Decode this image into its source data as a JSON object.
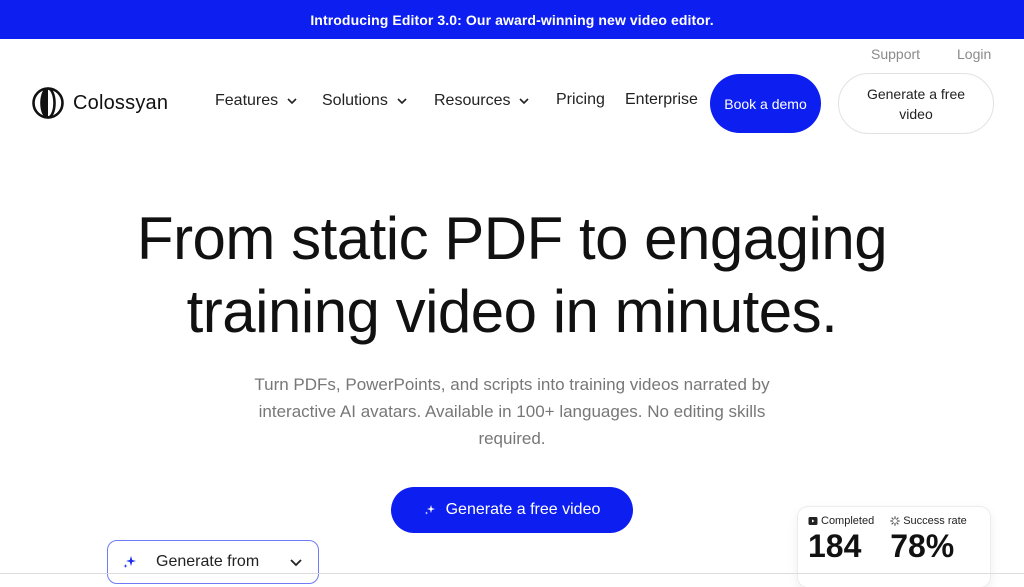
{
  "banner": {
    "text": "Introducing Editor 3.0: Our award-winning new video editor."
  },
  "utility_nav": {
    "support": "Support",
    "login": "Login"
  },
  "brand": {
    "name": "Colossyan"
  },
  "nav": {
    "items": [
      {
        "label": "Features",
        "has_dropdown": true
      },
      {
        "label": "Solutions",
        "has_dropdown": true
      },
      {
        "label": "Resources",
        "has_dropdown": true
      },
      {
        "label": "Pricing",
        "has_dropdown": false
      },
      {
        "label": "Enterprise",
        "has_dropdown": false
      }
    ],
    "book_demo": "Book a demo",
    "generate_free": "Generate a free video"
  },
  "hero": {
    "title_line1": "From static PDF to engaging",
    "title_line2": "training video in minutes.",
    "subtitle": "Turn PDFs, PowerPoints, and scripts into training videos narrated by interactive  AI avatars. Available in 100+ languages. No editing skills required.",
    "cta": "Generate a free video"
  },
  "generate_from": {
    "label": "Generate from"
  },
  "stats": {
    "completed_label": "Completed",
    "completed_value": "184",
    "success_label": "Success rate",
    "success_value": "78%"
  },
  "colors": {
    "brand_blue": "#0d1ff0",
    "muted_text": "#777777"
  },
  "icons": {
    "logo": "colossyan-logo-icon",
    "dropdown": "chevron-down-icon",
    "sparkle": "sparkle-icon",
    "completed": "video-icon",
    "success": "loading-icon"
  }
}
